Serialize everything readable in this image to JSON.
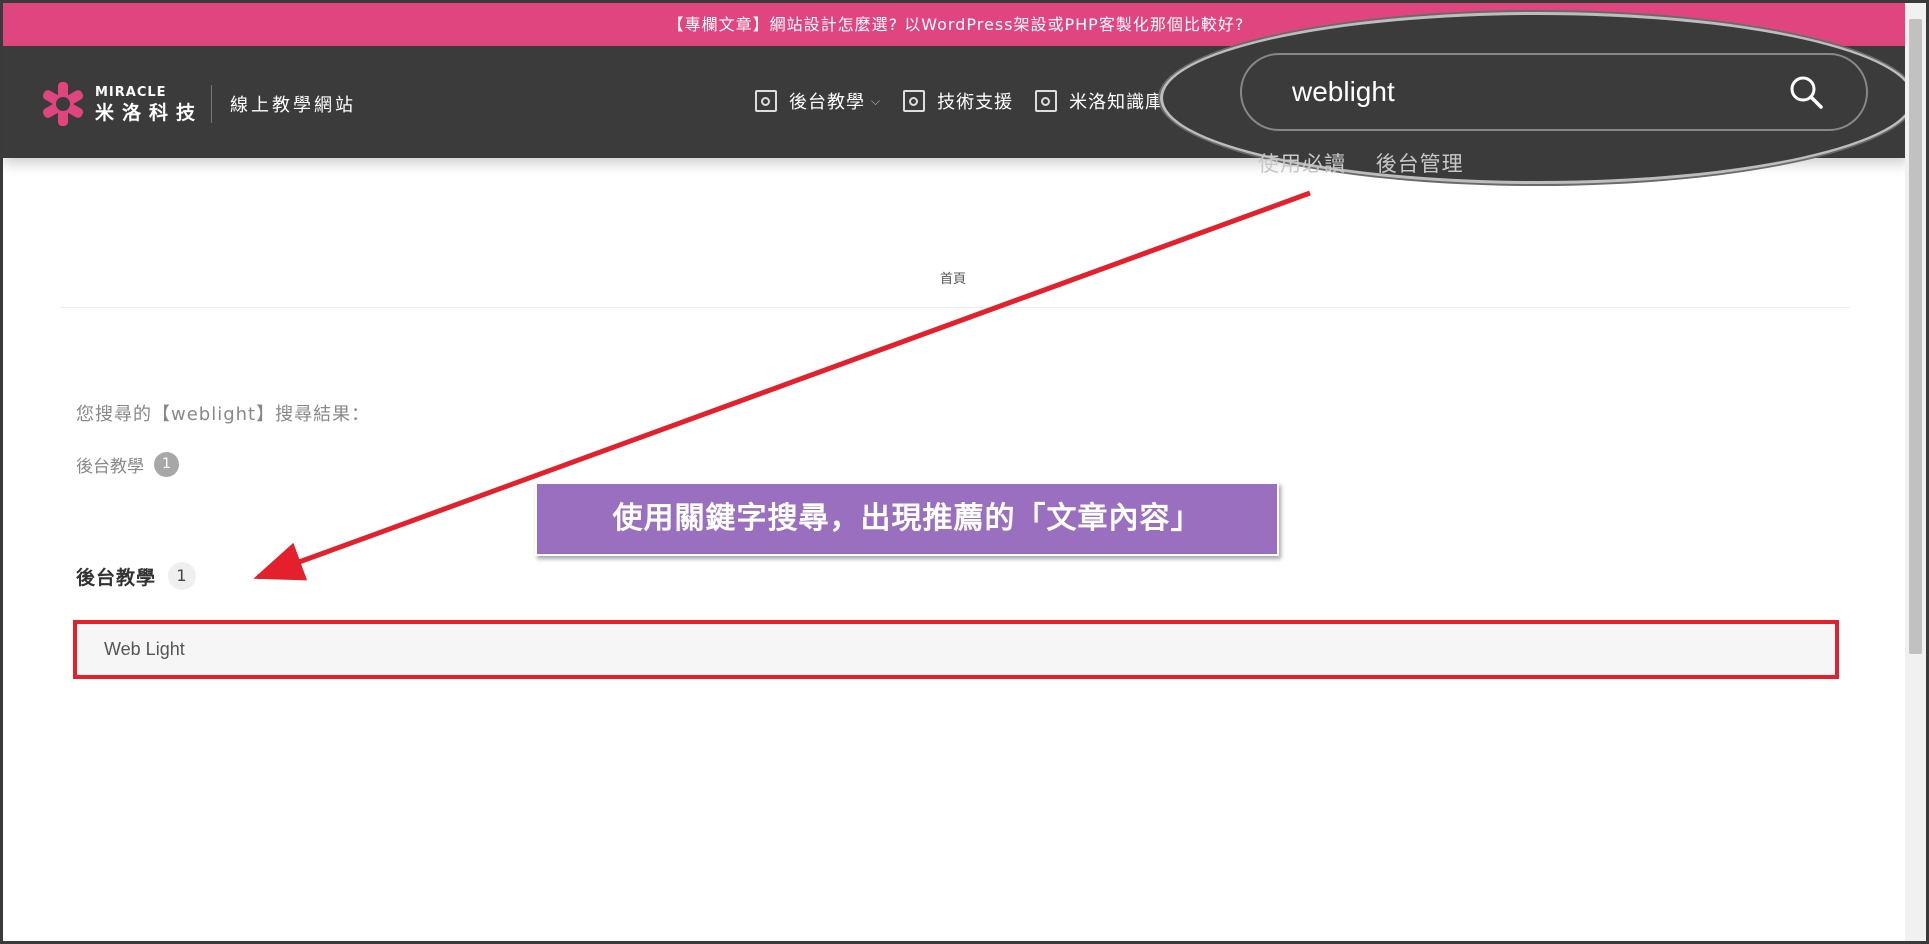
{
  "announcement": "【專欄文章】網站設計怎麼選? 以WordPress架設或PHP客製化那個比較好?",
  "logo": {
    "en": "MIRACLE",
    "cn": "米洛科技",
    "site": "線上教學網站"
  },
  "nav": [
    {
      "label": "後台教學",
      "has_caret": true
    },
    {
      "label": "技術支援",
      "has_caret": false
    },
    {
      "label": "米洛知識庫",
      "has_caret": false
    }
  ],
  "search": {
    "value": "weblight",
    "suggestions": [
      "使用必讀",
      "後台管理"
    ]
  },
  "breadcrumb": "首頁",
  "results": {
    "heading": "您搜尋的【weblight】搜尋結果：",
    "category_label": "後台教學",
    "category_count": "1",
    "section_title": "後台教學",
    "section_count": "1",
    "items": [
      "Web Light"
    ]
  },
  "annotation": "使用關鍵字搜尋，出現推薦的「文章內容」",
  "colors": {
    "brand_pink": "#e0457f",
    "header_dark": "#3b3b3b",
    "annotation_purple": "#9b6fc0",
    "highlight_red": "#e3202c"
  }
}
